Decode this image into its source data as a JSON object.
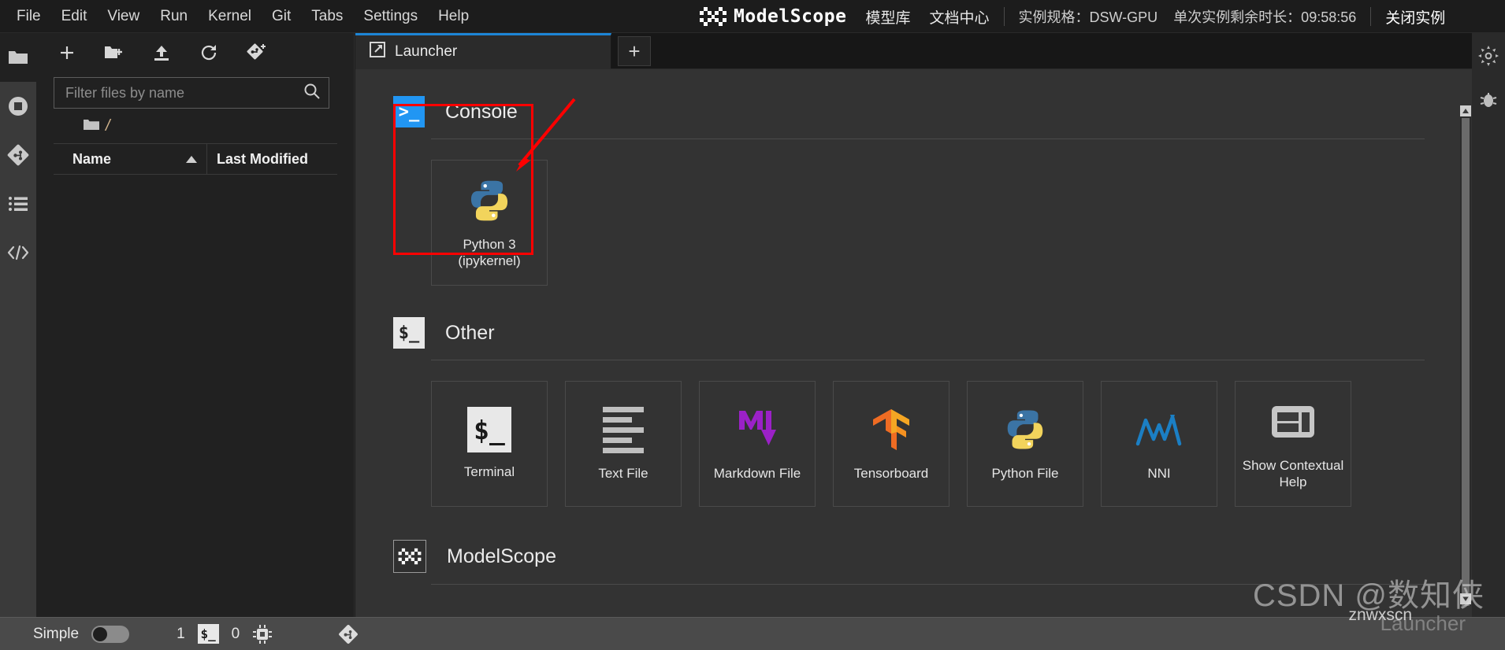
{
  "menubar": {
    "items": [
      {
        "label": "File",
        "name": "menu-file"
      },
      {
        "label": "Edit",
        "name": "menu-edit"
      },
      {
        "label": "View",
        "name": "menu-view"
      },
      {
        "label": "Run",
        "name": "menu-run"
      },
      {
        "label": "Kernel",
        "name": "menu-kernel"
      },
      {
        "label": "Git",
        "name": "menu-git"
      },
      {
        "label": "Tabs",
        "name": "menu-tabs"
      },
      {
        "label": "Settings",
        "name": "menu-settings"
      },
      {
        "label": "Help",
        "name": "menu-help"
      }
    ],
    "brand": "ModelScope",
    "links": [
      "模型库",
      "文档中心"
    ],
    "instance_spec": "实例规格：DSW-GPU",
    "instance_time": "单次实例剩余时长：09:58:56",
    "close_instance": "关闭实例"
  },
  "activitybar": {
    "items": [
      {
        "label": "File Browser",
        "icon": "folder-icon"
      },
      {
        "label": "Running Terminals and Kernels",
        "icon": "stop-circle-icon"
      },
      {
        "label": "Git",
        "icon": "git-icon"
      },
      {
        "label": "Table of Contents",
        "icon": "list-icon"
      },
      {
        "label": "Extension Manager",
        "icon": "code-icon"
      }
    ]
  },
  "filebrowser": {
    "toolbar": [
      {
        "label": "New Launcher",
        "icon": "plus-icon"
      },
      {
        "label": "New Folder",
        "icon": "new-folder-icon"
      },
      {
        "label": "Upload Files",
        "icon": "upload-icon"
      },
      {
        "label": "Refresh File List",
        "icon": "refresh-icon"
      },
      {
        "label": "Git Clone",
        "icon": "git-clone-icon"
      }
    ],
    "filter_placeholder": "Filter files by name",
    "filter_value": "",
    "breadcrumb_root": "/",
    "columns": {
      "name": "Name",
      "last_modified": "Last Modified"
    },
    "rows": []
  },
  "dock": {
    "tab_label": "Launcher",
    "tab_icon": "launcher-icon",
    "add_tab_label": "+"
  },
  "launcher": {
    "sections": [
      {
        "title": "Console",
        "icon": "console-icon",
        "cards": [
          {
            "label": "Python 3\n(ipykernel)",
            "icon": "python-icon",
            "name": "launcher-card-python3"
          }
        ]
      },
      {
        "title": "Other",
        "icon": "terminal-icon",
        "cards": [
          {
            "label": "Terminal",
            "icon": "terminal-icon",
            "name": "launcher-card-terminal"
          },
          {
            "label": "Text File",
            "icon": "text-file-icon",
            "name": "launcher-card-text-file"
          },
          {
            "label": "Markdown File",
            "icon": "markdown-icon",
            "name": "launcher-card-markdown-file"
          },
          {
            "label": "Tensorboard",
            "icon": "tensorflow-icon",
            "name": "launcher-card-tensorboard"
          },
          {
            "label": "Python File",
            "icon": "python-icon",
            "name": "launcher-card-python-file"
          },
          {
            "label": "NNI",
            "icon": "nni-icon",
            "name": "launcher-card-nni"
          },
          {
            "label": "Show Contextual Help",
            "icon": "contextual-help-icon",
            "name": "launcher-card-contextual-help"
          }
        ]
      },
      {
        "title": "ModelScope",
        "icon": "modelscope-icon",
        "cards": []
      }
    ]
  },
  "statusbar": {
    "mode_label": "Simple",
    "mode_on": false,
    "kernel_count": "1",
    "terminal_count": "0",
    "terminal_icon": "terminal-icon",
    "cpu_icon": "cpu-icon",
    "git_icon": "git-icon"
  },
  "watermark": {
    "main": "CSDN @数知侠",
    "sub": "znwxscn",
    "ghost": "Launcher"
  },
  "colors": {
    "accent_blue": "#1d85d6",
    "highlight_red": "#ff0000",
    "panel_bg": "#212121",
    "launcher_bg": "#333333",
    "statusbar_bg": "#4a4a4a"
  }
}
